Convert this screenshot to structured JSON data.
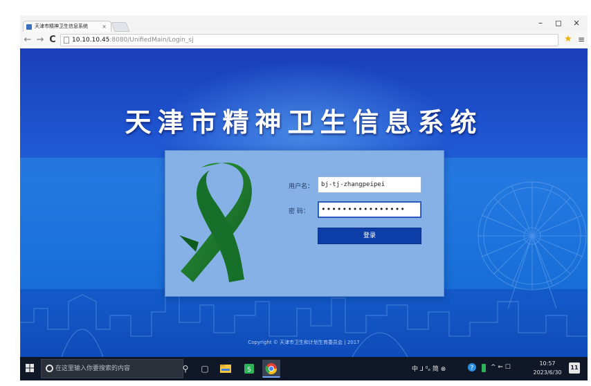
{
  "browser": {
    "tab_title": "天津市精神卫生信息系统",
    "tab_close": "×",
    "window_controls": {
      "minimize": "–",
      "restore": "◻",
      "close": "×"
    },
    "url_host": "10.10.10.45",
    "url_rest": ":8080/UnifiedMain/Login_sj",
    "nav": {
      "back": "←",
      "forward": "→",
      "reload": "C"
    },
    "star_icon": "star-icon",
    "menu_icon": "hamburger-menu-icon"
  },
  "page": {
    "title": "天津市精神卫生信息系统",
    "copyright": "Copyright © 天津市卫生和计划生育委员会 | 2017"
  },
  "login": {
    "username_label": "用户名：",
    "username_value": "bj-tj-zhangpeipei",
    "password_label": "密  码：",
    "password_value": "••••••••••••••••",
    "submit_label": "登录",
    "ribbon_color": "#1f7a2e"
  },
  "taskbar": {
    "search_placeholder": "在这里输入你要搜索的内容",
    "tray_text": "中 ⅃ ⁰ₒ 简 ⊗",
    "tray_arrows": "^ ⇐ ☐",
    "time": "10:57",
    "date": "2023/6/30",
    "notification_count": "11"
  },
  "colors": {
    "page_blue": "#1d5fd3",
    "panel": "#86b1e6",
    "button": "#0d3ea8",
    "taskbar": "#101828"
  }
}
